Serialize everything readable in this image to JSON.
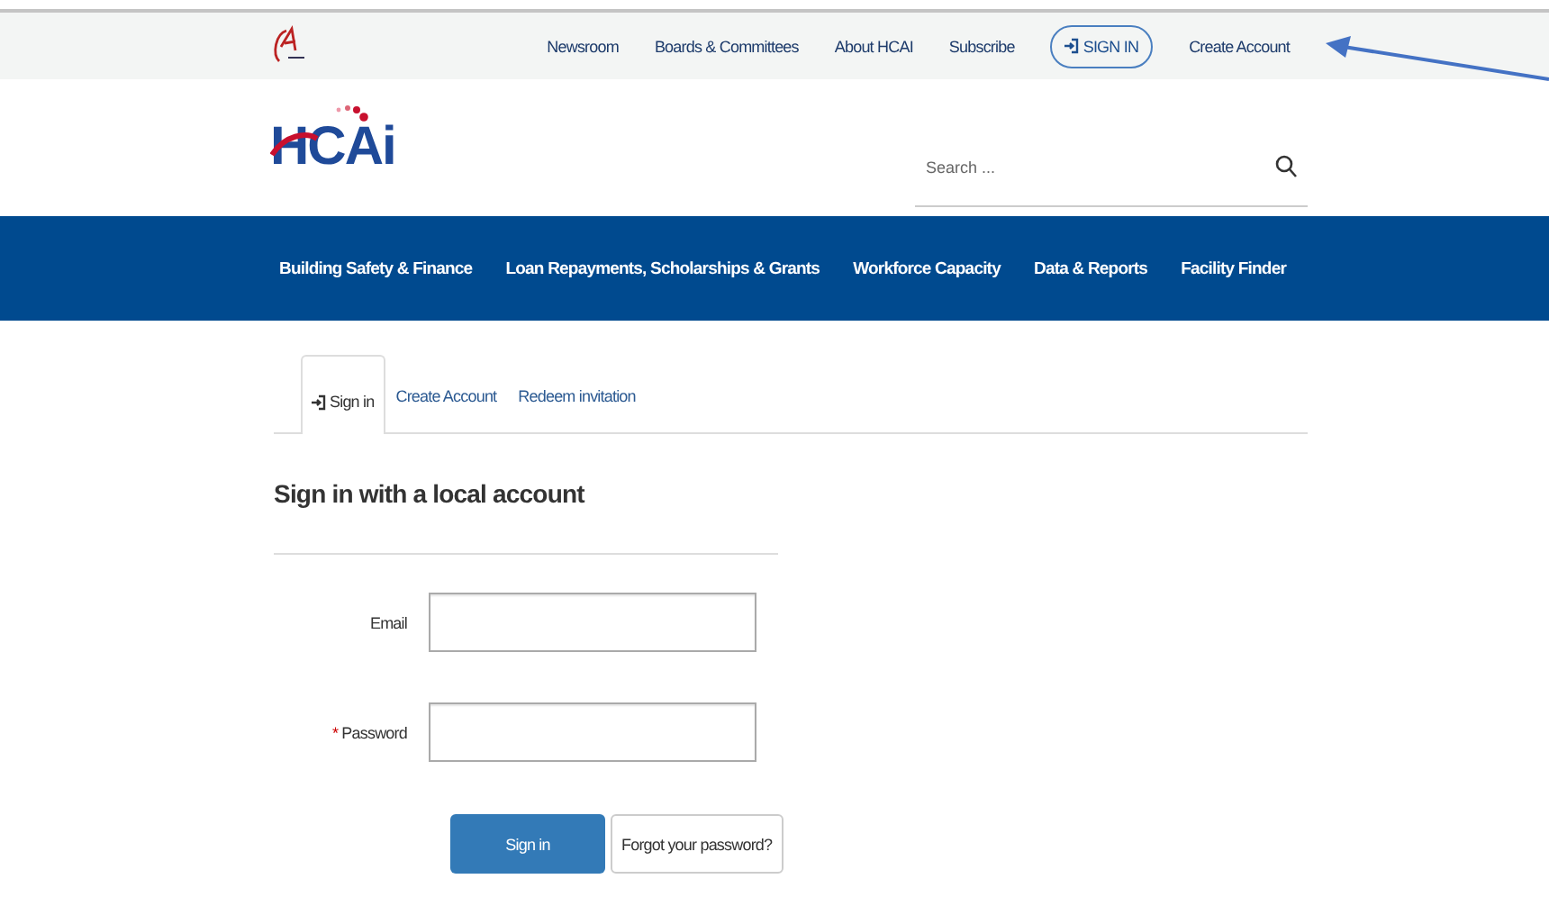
{
  "utility_nav": {
    "links": [
      "Newsroom",
      "Boards & Committees",
      "About HCAI",
      "Subscribe"
    ],
    "sign_in": "SIGN IN",
    "create_account": "Create Account"
  },
  "header": {
    "logo_text": "HCAi",
    "search": {
      "placeholder": "Search ..."
    }
  },
  "main_nav": [
    "Building Safety & Finance",
    "Loan Repayments, Scholarships & Grants",
    "Workforce Capacity",
    "Data & Reports",
    "Facility Finder"
  ],
  "tabs": [
    {
      "label": "Sign in",
      "selected": true
    },
    {
      "label": "Create Account",
      "selected": false
    },
    {
      "label": "Redeem invitation",
      "selected": false
    }
  ],
  "form": {
    "heading": "Sign in with a local account",
    "fields": [
      {
        "label": "Email",
        "required": false
      },
      {
        "label": "Password",
        "required": true
      }
    ],
    "required_mark": "*",
    "submit": "Sign in",
    "forgot": "Forgot your password?"
  }
}
